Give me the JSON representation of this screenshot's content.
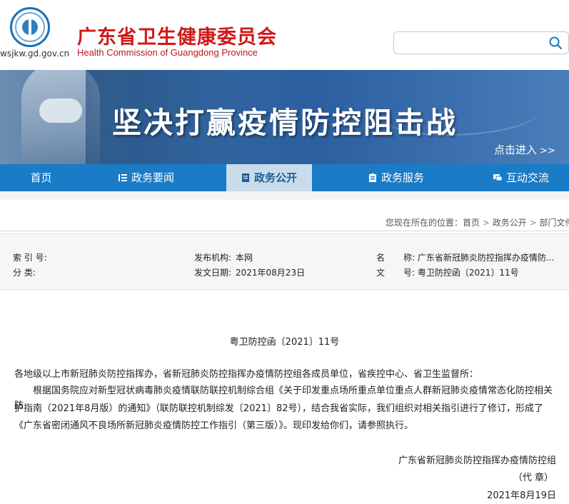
{
  "header": {
    "site_url": "wsjkw.gd.gov.cn",
    "title_cn": "广东省卫生健康委员会",
    "title_en": "Health Commission of Guangdong Province",
    "top_mark": "'",
    "search_placeholder": ""
  },
  "banner": {
    "title": "坚决打赢疫情防控阻击战",
    "link_label": "点击进入",
    "link_arrow": ">>"
  },
  "nav": {
    "items": [
      {
        "label": "首页",
        "icon": ""
      },
      {
        "label": "政务要闻",
        "icon": "list-icon"
      },
      {
        "label": "政务公开",
        "icon": "document-icon"
      },
      {
        "label": "政务服务",
        "icon": "clipboard-icon"
      },
      {
        "label": "互动交流",
        "icon": "chat-icon"
      }
    ],
    "active": "政务公开"
  },
  "breadcrumb": {
    "prefix": "您现在所在的位置：",
    "items": [
      "首页",
      "政务公开",
      "部门文件"
    ],
    "separator": ">"
  },
  "info": {
    "index_label": "索 引 号:",
    "index_value": "",
    "publisher_label": "发布机构:",
    "publisher_value": "本网",
    "name_label": "名",
    "name_value": "称: 广东省新冠肺炎防控指挥办疫情防...",
    "category_label": "分 类:",
    "category_value": "",
    "date_label": "发文日期:",
    "date_value": "2021年08月23日",
    "docno_label": "文",
    "docno_value": "号: 粤卫防控函〔2021〕11号"
  },
  "article": {
    "doc_number": "粤卫防控函〔2021〕11号",
    "recipients": "各地级以上市新冠肺炎防控指挥办，省新冠肺炎防控指挥办疫情防控组各成员单位，省疾控中心、省卫生监督所：",
    "body_line1": "　　根据国务院应对新型冠状病毒肺炎疫情联防联控机制综合组《关于印发重点场所重点单位重点人群新冠肺炎疫情常态化防控相关防",
    "body_line2": "护指南（2021年8月版）的通知》（联防联控机制综发〔2021〕82号），结合我省实际，我们组织对相关指引进行了修订，形成了",
    "body_line3": "《广东省密闭通风不良场所新冠肺炎疫情防控工作指引（第三版）》。现印发给你们，请参照执行。",
    "signatory": "广东省新冠肺炎防控指挥办疫情防控组",
    "signatory_note": "（代 章）",
    "sign_date": "2021年8月19日"
  }
}
